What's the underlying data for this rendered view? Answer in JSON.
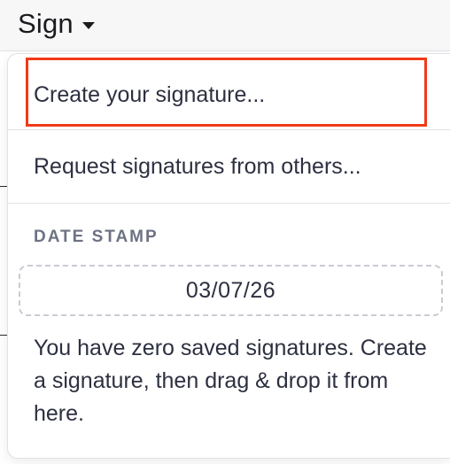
{
  "toolbar": {
    "sign_label": "Sign",
    "caret_icon": "caret-down-icon"
  },
  "menu": {
    "create_signature": "Create your signature...",
    "request_signatures": "Request signatures from others...",
    "date_stamp_heading": "DATE STAMP",
    "date_stamp_value": "03/07/26",
    "empty_note": "You have zero saved signatures. Create a signature, then drag & drop it from here."
  },
  "colors": {
    "highlight": "#f03a17",
    "text": "#2d3040",
    "heading": "#6d7283"
  }
}
